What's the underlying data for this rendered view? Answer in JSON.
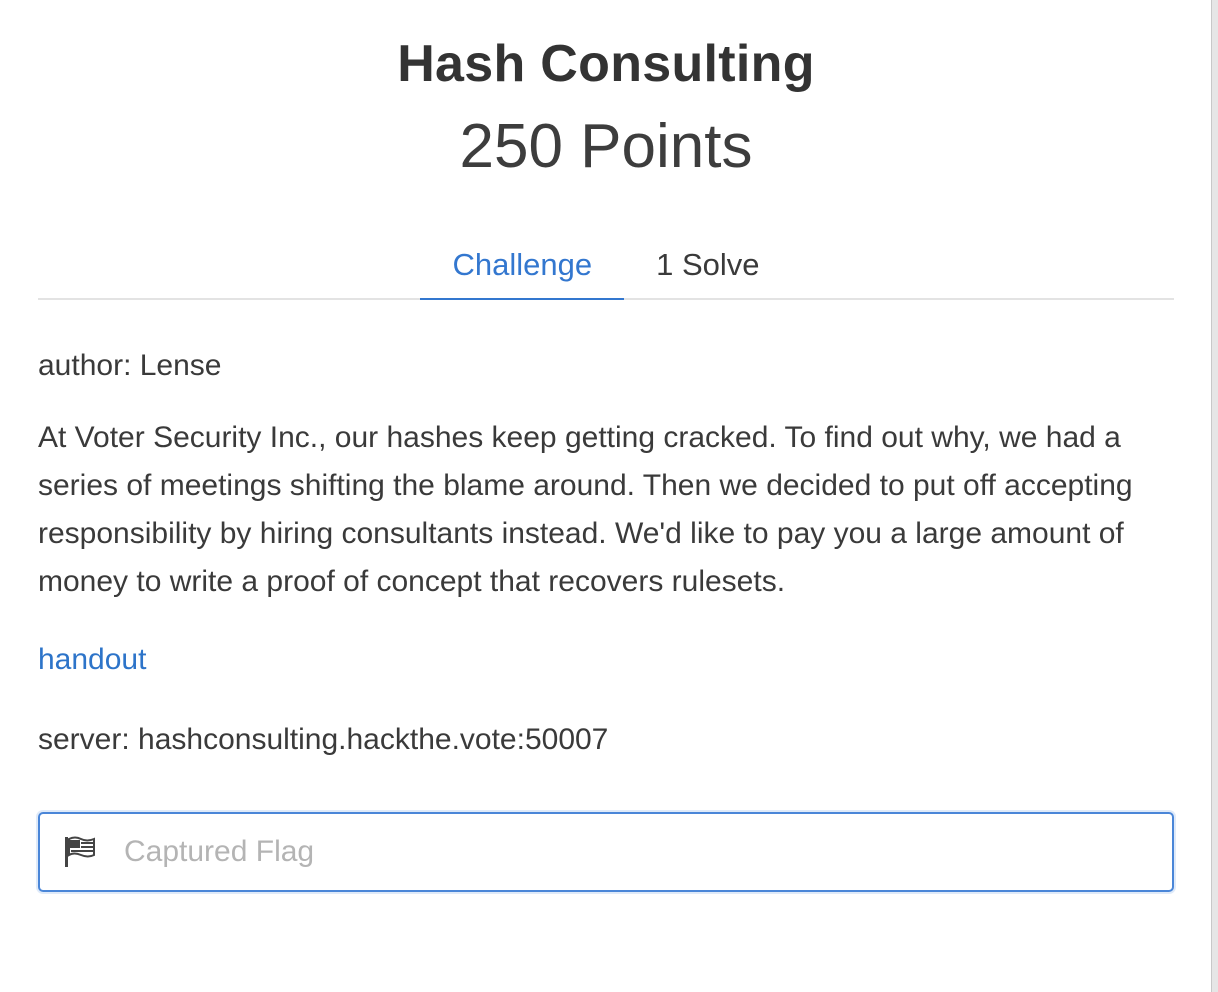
{
  "challenge": {
    "title": "Hash Consulting",
    "points": "250 Points"
  },
  "tabs": [
    {
      "label": "Challenge",
      "active": true
    },
    {
      "label": "1 Solve",
      "active": false
    }
  ],
  "body": {
    "author": "author: Lense",
    "description": "At Voter Security Inc., our hashes keep getting cracked. To find out why, we had a series of meetings shifting the blame around. Then we decided to put off accepting responsibility by hiring consultants instead. We'd like to pay you a large amount of money to write a proof of concept that recovers rulesets.",
    "handout_label": "handout",
    "server": "server: hashconsulting.hackthe.vote:50007"
  },
  "flag_input": {
    "placeholder": "Captured Flag",
    "value": "",
    "icon": "flag-icon"
  },
  "colors": {
    "accent": "#3377cf",
    "link": "#2d74c9",
    "text": "#3a3a3a",
    "placeholder": "#b4b4b4"
  }
}
